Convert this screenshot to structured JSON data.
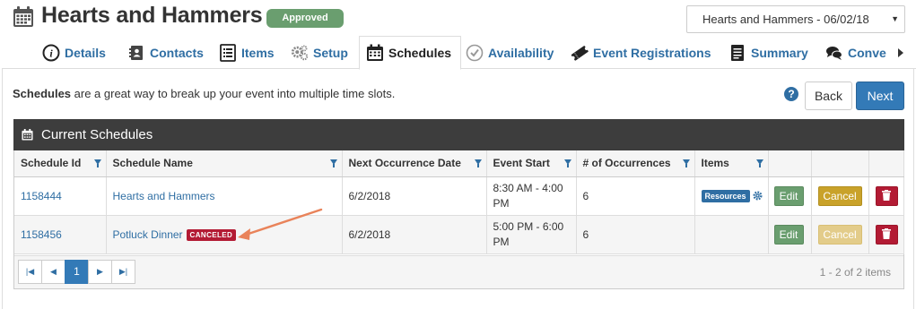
{
  "event": {
    "title": "Hearts and Hammers",
    "status": "Approved",
    "selector_value": "Hearts and Hammers - 06/02/18"
  },
  "tabs": [
    {
      "label": "Details",
      "icon": "info-icon"
    },
    {
      "label": "Contacts",
      "icon": "address-book-icon"
    },
    {
      "label": "Items",
      "icon": "list-icon"
    },
    {
      "label": "Setup",
      "icon": "gears-icon"
    },
    {
      "label": "Schedules",
      "icon": "calendar-icon",
      "active": true
    },
    {
      "label": "Availability",
      "icon": "check-circle-icon"
    },
    {
      "label": "Event Registrations",
      "icon": "ticket-icon"
    },
    {
      "label": "Summary",
      "icon": "document-icon"
    },
    {
      "label": "Conve",
      "icon": "chat-icon"
    }
  ],
  "intro": {
    "bold": "Schedules",
    "rest": " are a great way to break up your event into multiple time slots."
  },
  "buttons": {
    "back": "Back",
    "next": "Next",
    "help": "?"
  },
  "grid": {
    "title": "Current Schedules",
    "columns": [
      "Schedule Id",
      "Schedule Name",
      "Next Occurrence Date",
      "Event Start",
      "# of Occurrences",
      "Items",
      "",
      "",
      ""
    ],
    "rows": [
      {
        "id": "1158444",
        "name": "Hearts and Hammers",
        "badge": "",
        "next_date": "6/2/2018",
        "event_start": "8:30 AM - 4:00 PM",
        "occurrences": "6",
        "items_badge": "Resources",
        "edit": "Edit",
        "cancel": "Cancel"
      },
      {
        "id": "1158456",
        "name": "Potluck Dinner",
        "badge": "CANCELED",
        "next_date": "6/2/2018",
        "event_start": "5:00 PM - 6:00 PM",
        "occurrences": "6",
        "items_badge": "",
        "edit": "Edit",
        "cancel": "Cancel"
      }
    ],
    "pager": {
      "current_page": "1",
      "summary": "1 - 2 of 2 items"
    }
  },
  "colors": {
    "link": "#2f6ea3",
    "approved": "#6a9e6f",
    "canceled": "#b31b34",
    "cancel_button": "#c9a22a",
    "primary": "#337ab7",
    "annotation_arrow": "#e9835a"
  }
}
